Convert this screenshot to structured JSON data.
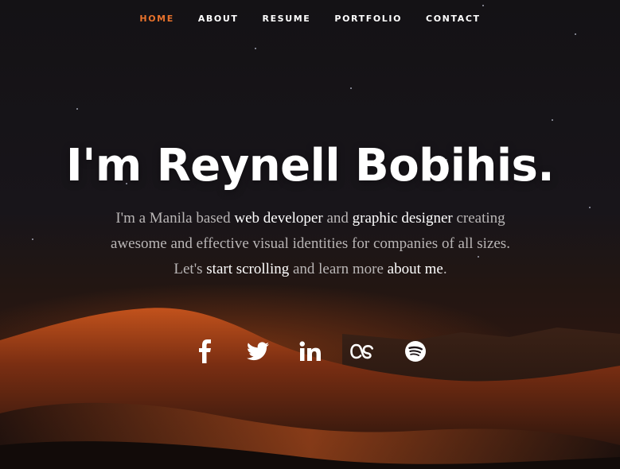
{
  "nav": {
    "items": [
      {
        "label": "HOME",
        "active": true
      },
      {
        "label": "ABOUT",
        "active": false
      },
      {
        "label": "RESUME",
        "active": false
      },
      {
        "label": "PORTFOLIO",
        "active": false
      },
      {
        "label": "CONTACT",
        "active": false
      }
    ],
    "active_color": "#e8722c"
  },
  "hero": {
    "headline": "I'm Reynell Bobihis.",
    "intro": {
      "part1": "I'm a Manila based ",
      "hl1": "web developer",
      "part2": " and ",
      "hl2": "graphic designer",
      "part3": " creating awesome and effective visual identities for companies of all sizes. Let's ",
      "hl3": "start scrolling",
      "part4": " and learn more ",
      "hl4": "about me",
      "part5": "."
    }
  },
  "social": [
    {
      "icon": "facebook-icon"
    },
    {
      "icon": "twitter-icon"
    },
    {
      "icon": "linkedin-icon"
    },
    {
      "icon": "lastfm-icon"
    },
    {
      "icon": "spotify-icon"
    }
  ]
}
